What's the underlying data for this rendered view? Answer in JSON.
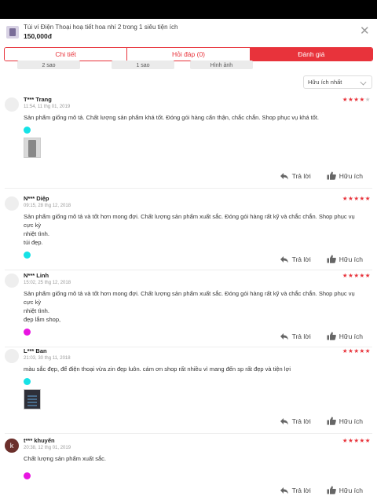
{
  "product": {
    "name": "Túi ví Điện Thoại hoạ tiết hoa nhí 2 trong 1 siêu tiện ích",
    "price": "150,000đ",
    "close_icon": "close-icon"
  },
  "tabs": [
    {
      "label": "Chi tiết",
      "active": false
    },
    {
      "label": "Hỏi đáp (0)",
      "active": false
    },
    {
      "label": "Đánh giá",
      "active": true
    }
  ],
  "filters": [
    "2 sao",
    "1 sao",
    "Hình ảnh"
  ],
  "sort": {
    "selected": "Hữu ích nhất"
  },
  "actions": {
    "reply": "Trả lời",
    "helpful": "Hữu ích"
  },
  "colors": {
    "accent": "#e8333b",
    "cyan": "#15e2e6",
    "magenta": "#e815e1"
  },
  "reviews": [
    {
      "name": "T*** Trang",
      "date": "11:54, 11 thg 01, 2019",
      "rating": 4,
      "text": "Sản phẩm giống mô tả. Chất lượng sản phẩm khá tốt. Đóng gói hàng cẩn thận, chắc chắn. Shop phục vụ khá tốt.",
      "dot": "cyan",
      "photo": true
    },
    {
      "name": "N*** Diệp",
      "date": "09:15, 28 thg 12, 2018",
      "rating": 5,
      "text_lines": [
        "Sản phẩm giống mô tả và tốt hơn mong đợi. Chất lượng sản phẩm xuất sắc. Đóng gói hàng rất kỹ và chắc chắn. Shop phục vụ cực kỳ",
        "nhiệt tình.",
        "túi đẹp."
      ],
      "dot": "cyan",
      "photo": false
    },
    {
      "name": "N*** Linh",
      "date": "15:02, 25 thg 12, 2018",
      "rating": 5,
      "text_lines": [
        "Sản phẩm giống mô tả và tốt hơn mong đợi. Chất lượng sản phẩm xuất sắc. Đóng gói hàng rất kỹ và chắc chắn. Shop phục vụ cực kỳ",
        "nhiệt tình.",
        "đẹp lắm shop,"
      ],
      "dot": "magenta",
      "photo": false
    },
    {
      "name": "L*** Ban",
      "date": "21:03, 30 thg 11, 2018",
      "rating": 5,
      "text": "màu sắc đẹp, để điện thoại vừa zin đẹp luôn. cám ơn shop rất nhiều vì mang đến sp rất đẹp và tiện lợi",
      "dot": "cyan",
      "photo": true
    },
    {
      "name": "t*** khuyến",
      "avatar_letter": "k",
      "date": "20:38, 12 thg 01, 2019",
      "rating": 5,
      "text": "Chất lượng sản phẩm xuất sắc.",
      "dot": "magenta",
      "photo": false
    }
  ]
}
